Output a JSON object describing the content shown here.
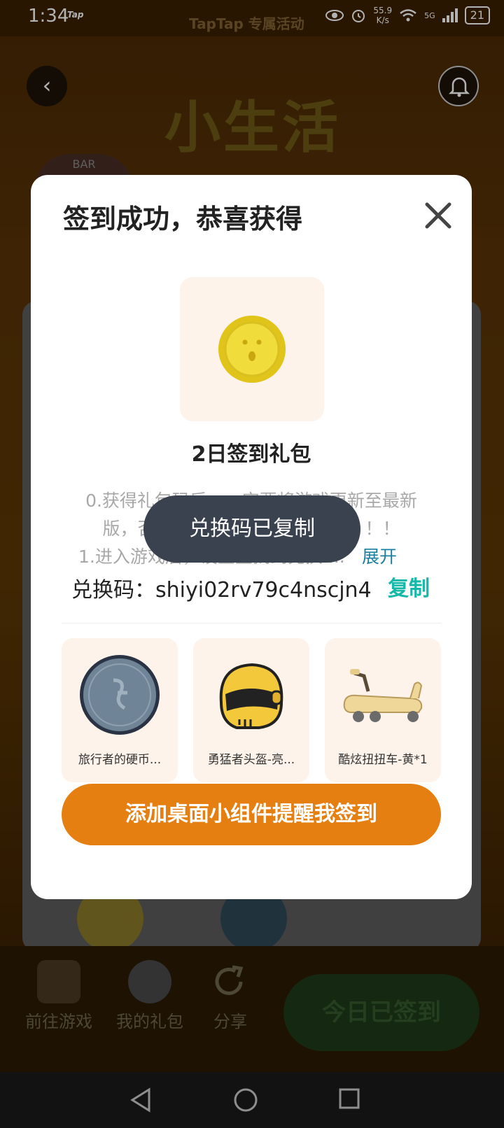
{
  "status_bar": {
    "time": "1:34",
    "app_tag": "Tap",
    "banner_text": "TapTap 专属活动",
    "net_speed": "55.9",
    "net_unit": "K/s",
    "signal": "5G",
    "battery": "21"
  },
  "hero": {
    "title": "小生活",
    "bar_sign": "BAR"
  },
  "dialog": {
    "title": "签到成功，恭喜获得",
    "gift_name": "2日签到礼包",
    "description_line1": "0.获得礼包码后，一定要将游戏更新至最新",
    "description_line2": "版，否则会无法兑换！！！重要！！！",
    "description_line3": "1.进入游戏后，设置里找到兑换 ...",
    "expand_label": "展开",
    "code_label": "兑换码：",
    "code_value": "shiyi02rv79c4nscjn4",
    "copy_label": "复制",
    "items": [
      {
        "label": "旅行者的硬币..."
      },
      {
        "label": "勇猛者头盔-亮..."
      },
      {
        "label": "酷炫扭扭车-黄*1"
      }
    ],
    "cta_label": "添加桌面小组件提醒我签到"
  },
  "toast": {
    "text": "兑换码已复制"
  },
  "bottom_bar": {
    "go_game": "前往游戏",
    "my_gifts": "我的礼包",
    "share": "分享",
    "checked_in": "今日已签到"
  },
  "colors": {
    "accent_orange": "#e57f12",
    "copy_teal": "#16b8a8",
    "expand_blue": "#1a7fa0",
    "toast_bg": "#3a4250"
  }
}
